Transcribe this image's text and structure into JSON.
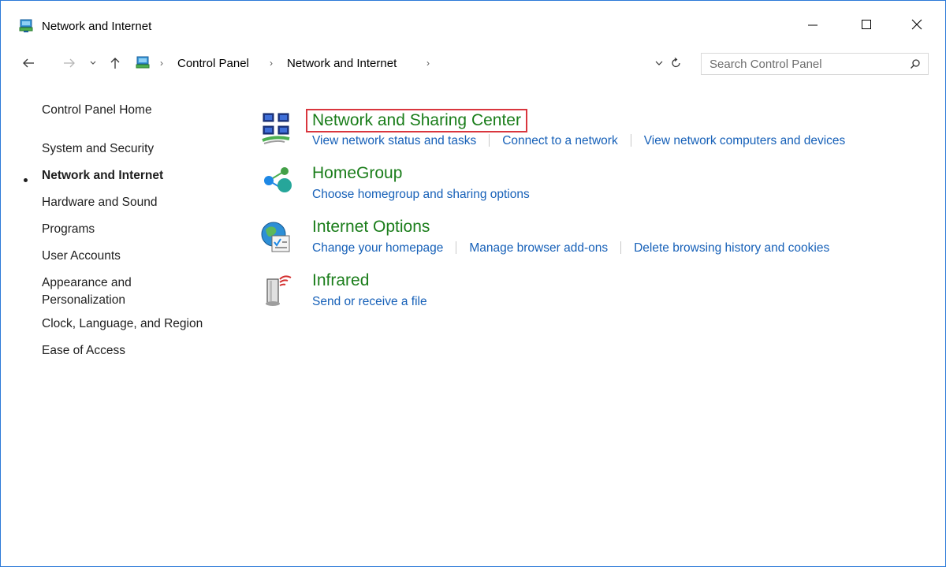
{
  "window": {
    "title": "Network and Internet",
    "controls": {
      "minimize": "minimize-icon",
      "maximize": "maximize-icon",
      "close": "close-icon"
    }
  },
  "address_bar": {
    "breadcrumbs": [
      "Control Panel",
      "Network and Internet"
    ],
    "search_placeholder": "Search Control Panel"
  },
  "sidebar": {
    "items": [
      {
        "label": "Control Panel Home"
      },
      {
        "label": "System and Security"
      },
      {
        "label": "Network and Internet",
        "active": true
      },
      {
        "label": "Hardware and Sound"
      },
      {
        "label": "Programs"
      },
      {
        "label": "User Accounts"
      },
      {
        "label": "Appearance and"
      },
      {
        "label": "Personalization"
      },
      {
        "label": "Clock, Language, and Region"
      },
      {
        "label": "Ease of Access"
      }
    ]
  },
  "sections": [
    {
      "title": "Network and Sharing Center",
      "icon": "network-sharing-icon",
      "highlighted": true,
      "tasks": [
        "View network status and tasks",
        "Connect to a network",
        "View network computers and devices"
      ]
    },
    {
      "title": "HomeGroup",
      "icon": "homegroup-icon",
      "tasks": [
        "Choose homegroup and sharing options"
      ]
    },
    {
      "title": "Internet Options",
      "icon": "internet-options-icon",
      "tasks": [
        "Change your homepage",
        "Manage browser add-ons",
        "Delete browsing history and cookies"
      ]
    },
    {
      "title": "Infrared",
      "icon": "infrared-icon",
      "tasks": [
        "Send or receive a file"
      ]
    }
  ],
  "colors": {
    "title_green": "#1a7d1a",
    "link_blue": "#1660b8",
    "highlight_red": "#d9363e",
    "window_border": "#2b79d8"
  }
}
